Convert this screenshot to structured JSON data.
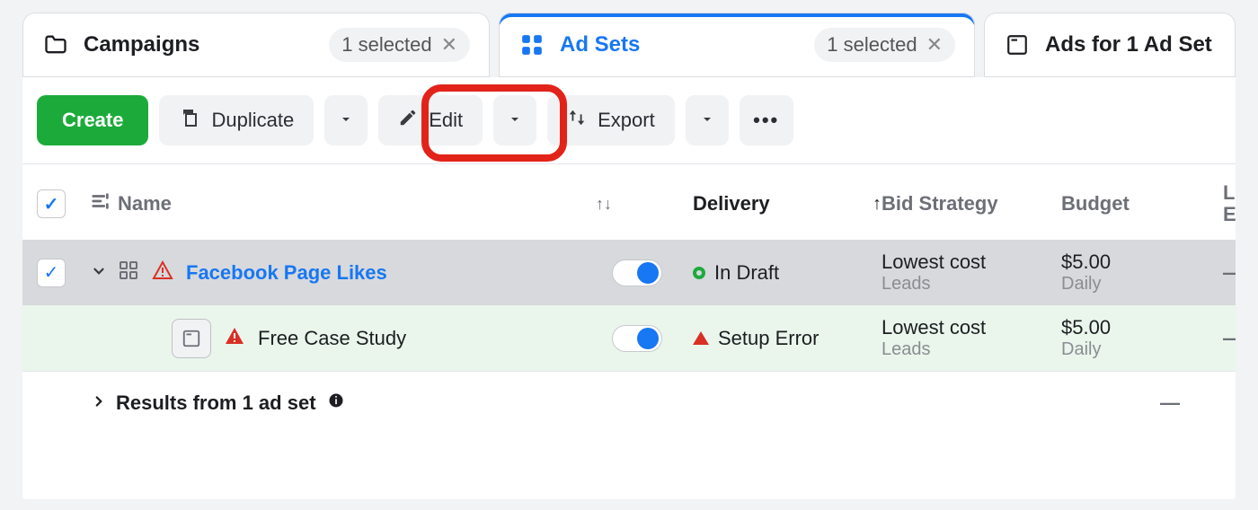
{
  "tabs": {
    "campaigns": {
      "label": "Campaigns",
      "chip": "1 selected"
    },
    "adsets": {
      "label": "Ad Sets",
      "chip": "1 selected"
    },
    "ads": {
      "label": "Ads for 1 Ad Set"
    }
  },
  "toolbar": {
    "create": "Create",
    "duplicate": "Duplicate",
    "edit": "Edit",
    "export": "Export"
  },
  "columns": {
    "name": "Name",
    "delivery": "Delivery",
    "bid": "Bid Strategy",
    "budget": "Budget",
    "last": "Last S\nEdit"
  },
  "rows": [
    {
      "name": "Facebook Page Likes",
      "name_is_link": true,
      "warning": true,
      "delivery": "In Draft",
      "delivery_state": "draft",
      "bid": "Lowest cost",
      "bid_sub": "Leads",
      "budget": "$5.00",
      "budget_sub": "Daily",
      "last": "—",
      "selected": true,
      "toggle_on": true,
      "level": "adset"
    },
    {
      "name": "Free Case Study",
      "name_is_link": false,
      "warning": true,
      "delivery": "Setup Error",
      "delivery_state": "error",
      "bid": "Lowest cost",
      "bid_sub": "Leads",
      "budget": "$5.00",
      "budget_sub": "Daily",
      "last": "—",
      "selected": false,
      "toggle_on": true,
      "level": "ad"
    }
  ],
  "results": {
    "label": "Results from 1 ad set",
    "last": "—"
  }
}
